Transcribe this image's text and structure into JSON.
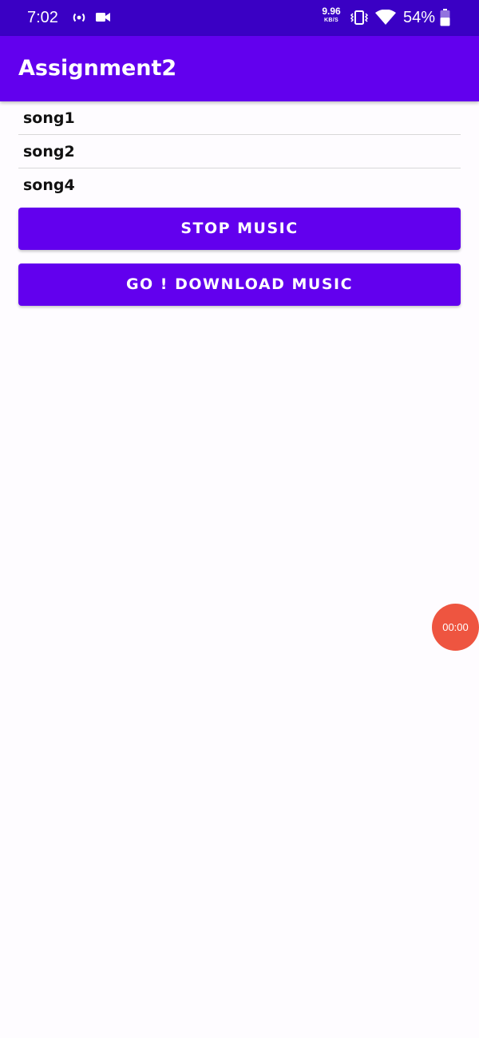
{
  "status_bar": {
    "time": "7:02",
    "network_speed_value": "9.96",
    "network_speed_unit": "KB/S",
    "battery_percent": "54%"
  },
  "app_bar": {
    "title": "Assignment2"
  },
  "songs": [
    {
      "label": "song1"
    },
    {
      "label": "song2"
    },
    {
      "label": "song4"
    }
  ],
  "buttons": {
    "stop_label": "STOP MUSIC",
    "download_label": "GO ! DOWNLOAD MUSIC"
  },
  "recorder": {
    "timer": "00:00"
  },
  "colors": {
    "status_bar": "#3a00c4",
    "primary": "#6200ee",
    "timer_bubble": "#ee5540"
  },
  "icons": [
    "broadcast-icon",
    "video-camera-icon",
    "vibrate-icon",
    "wifi-icon",
    "battery-icon"
  ]
}
